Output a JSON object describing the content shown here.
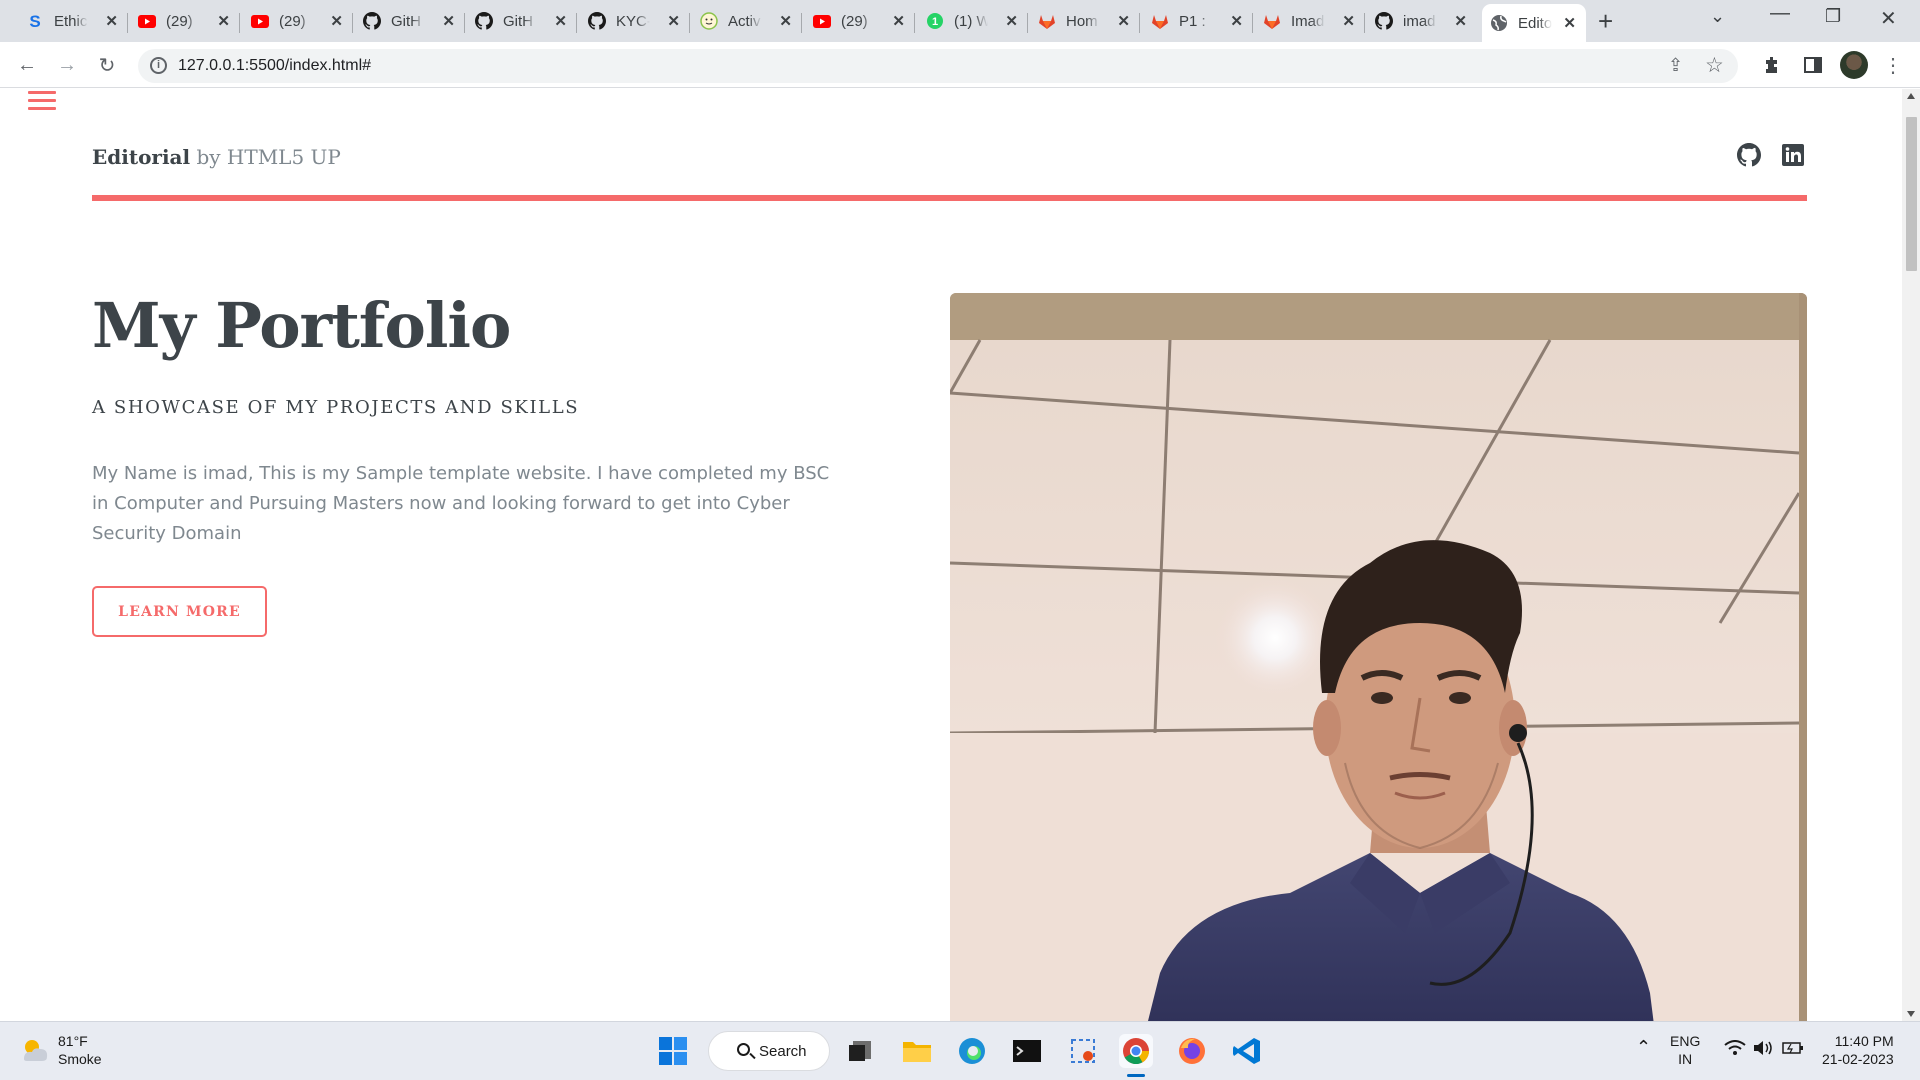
{
  "browser": {
    "tabs": [
      {
        "title": "Ethic",
        "icon": "s-logo-icon",
        "color": "#1a73e8"
      },
      {
        "title": "(29)",
        "icon": "youtube-icon",
        "color": "#ff0000"
      },
      {
        "title": "(29)",
        "icon": "youtube-icon",
        "color": "#ff0000"
      },
      {
        "title": "GitH",
        "icon": "github-icon",
        "color": "#1a1a1a"
      },
      {
        "title": "GitH",
        "icon": "github-icon",
        "color": "#1a1a1a"
      },
      {
        "title": "KYC-",
        "icon": "github-icon",
        "color": "#1a1a1a"
      },
      {
        "title": "Activ",
        "icon": "smiley-icon",
        "color": "#8bc34a"
      },
      {
        "title": "(29)",
        "icon": "youtube-icon",
        "color": "#ff0000"
      },
      {
        "title": "(1) W",
        "icon": "whatsapp-badge-icon",
        "color": "#25d366"
      },
      {
        "title": "Hom",
        "icon": "gitlab-icon",
        "color": "#e24329"
      },
      {
        "title": "P1 :",
        "icon": "gitlab-icon",
        "color": "#e24329"
      },
      {
        "title": "Imad",
        "icon": "gitlab-icon",
        "color": "#e24329"
      },
      {
        "title": "imad",
        "icon": "github-icon",
        "color": "#1a1a1a"
      },
      {
        "title": "Edito",
        "icon": "globe-icon",
        "color": "#5f6368",
        "active": true
      }
    ],
    "url": "127.0.0.1:5500/index.html#"
  },
  "site": {
    "logo_strong": "Editorial",
    "logo_rest": " by HTML5 UP",
    "accent": "#f56a6a",
    "social_icons": [
      "github-icon",
      "linkedin-icon"
    ]
  },
  "banner": {
    "title": "My Portfolio",
    "subtitle": "A SHOWCASE OF MY PROJECTS AND SKILLS",
    "text": "My Name is imad, This is my Sample template website. I have completed my BSC in Computer and Pursuing Masters now and looking forward to get into Cyber Security Domain",
    "button": "LEARN MORE"
  },
  "taskbar": {
    "weather_temp": "81°F",
    "weather_desc": "Smoke",
    "search_label": "Search",
    "lang_top": "ENG",
    "lang_bottom": "IN",
    "time": "11:40 PM",
    "date": "21-02-2023"
  }
}
